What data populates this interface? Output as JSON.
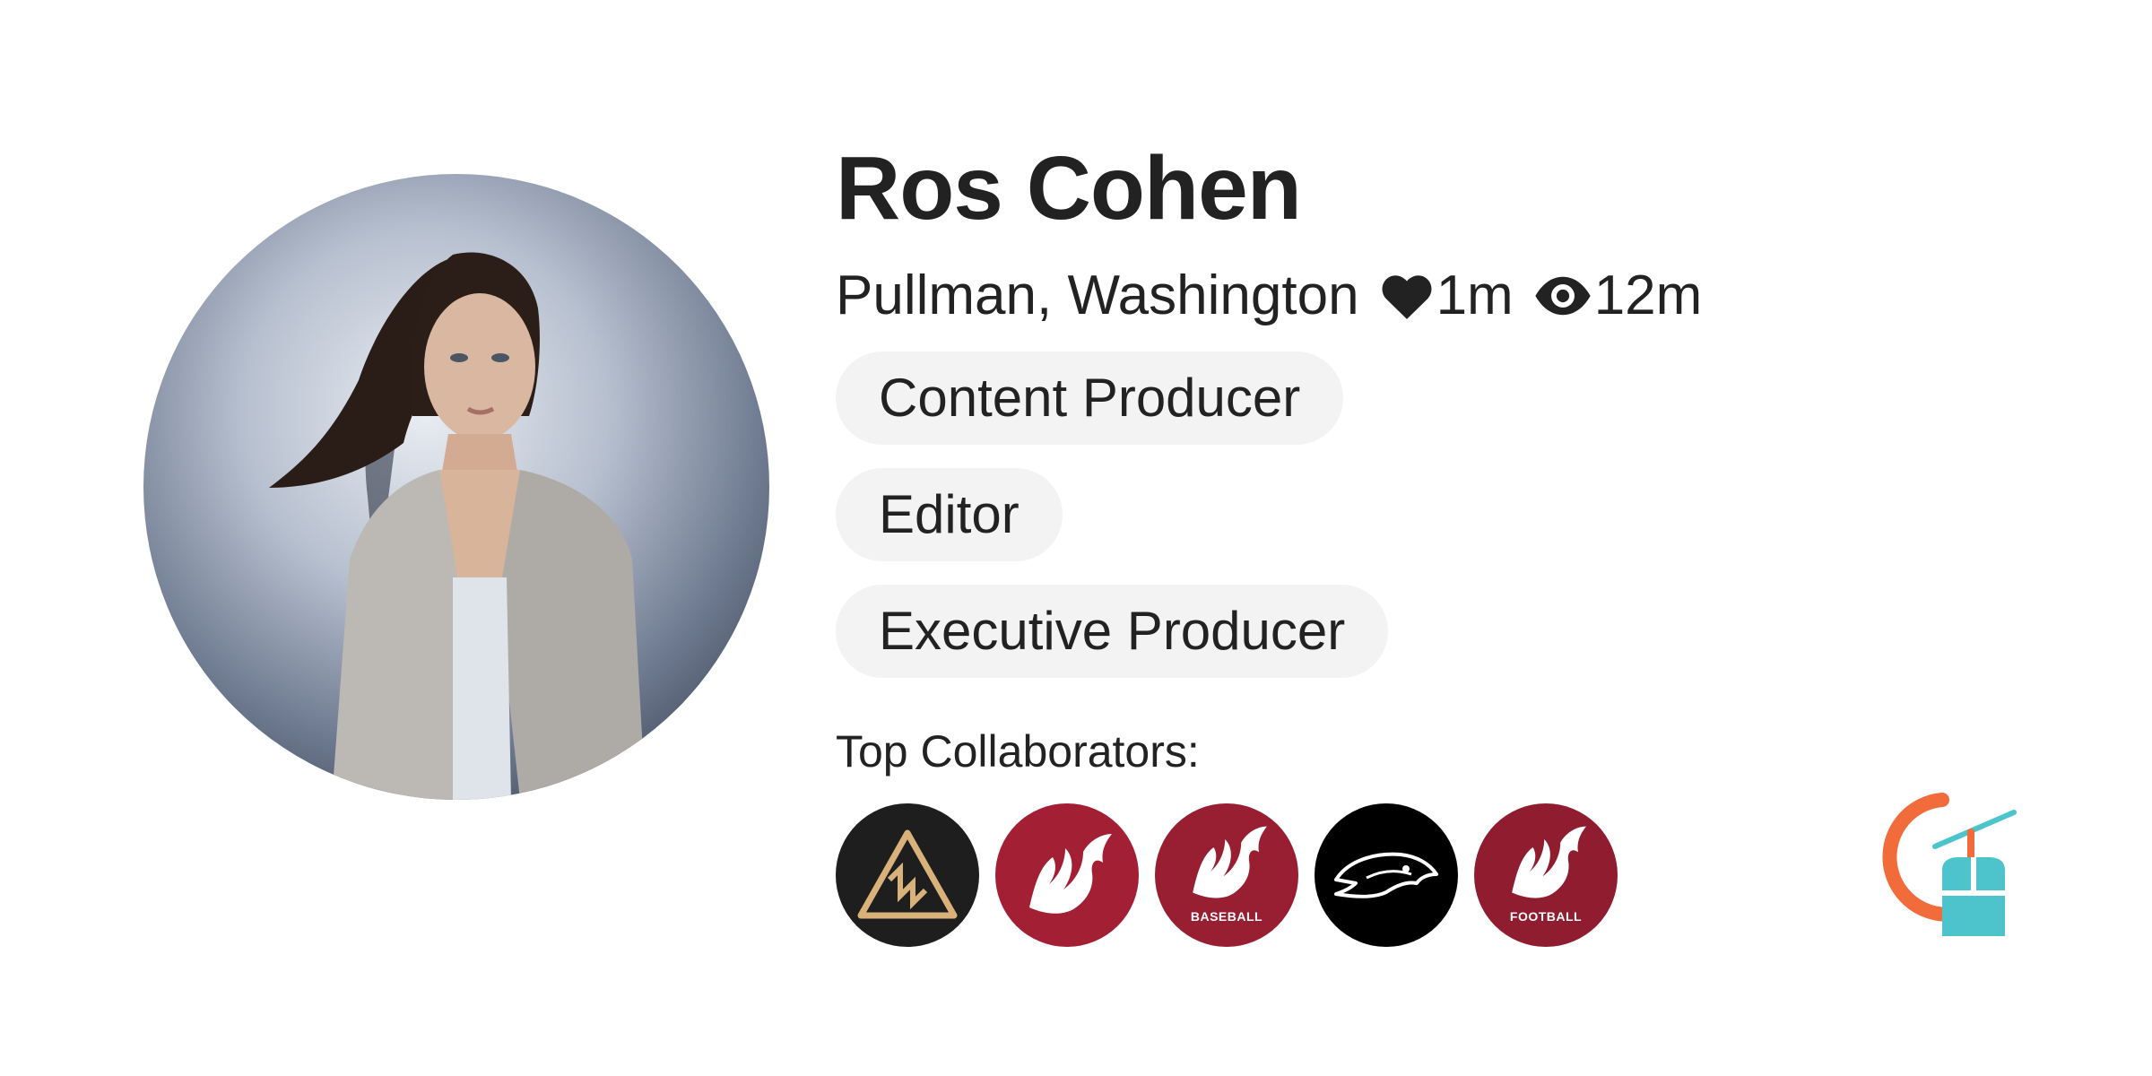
{
  "profile": {
    "name": "Ros Cohen",
    "location": "Pullman, Washington",
    "likes": "1m",
    "views": "12m",
    "avatar_icon": "person-photo"
  },
  "roles": [
    "Content Producer",
    "Editor",
    "Executive Producer"
  ],
  "collaborators": {
    "title": "Top Collaborators:",
    "items": [
      {
        "logo": "triangle-lnl-logo",
        "bg": "#1e1e1e",
        "caption": ""
      },
      {
        "logo": "wsu-cougar-logo",
        "bg": "#a31f34",
        "caption": ""
      },
      {
        "logo": "wsu-cougar-logo",
        "bg": "#981e32",
        "caption": "BASEBALL"
      },
      {
        "logo": "seahawks-logo",
        "bg": "#000000",
        "caption": ""
      },
      {
        "logo": "wsu-cougar-logo",
        "bg": "#8f1d2f",
        "caption": "FOOTBALL"
      }
    ]
  },
  "colors": {
    "text": "#222222",
    "tag_bg": "#f3f3f3",
    "brand_orange": "#f26b3a",
    "brand_teal": "#4dc4cc"
  }
}
